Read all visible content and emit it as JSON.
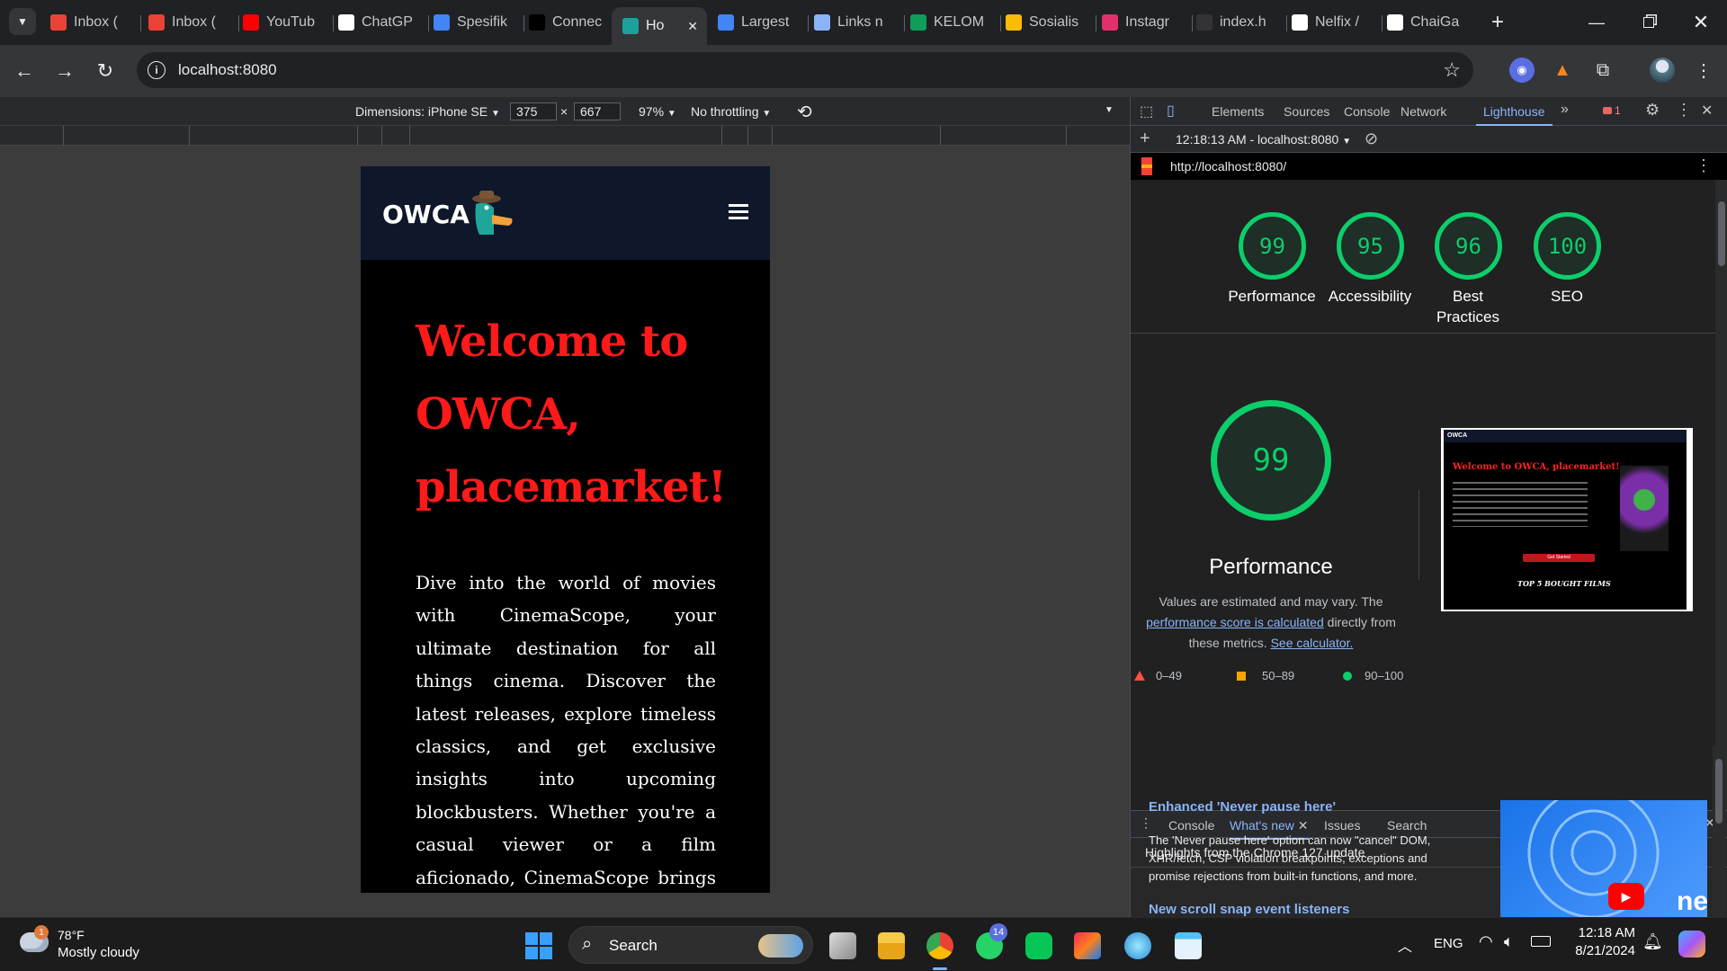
{
  "browser": {
    "tabs": [
      {
        "label": "Inbox (",
        "icon": "gmail-icon",
        "color": "#ea4335"
      },
      {
        "label": "Inbox (",
        "icon": "gmail-icon",
        "color": "#ea4335"
      },
      {
        "label": "YouTub",
        "icon": "youtube-icon",
        "color": "#ff0000"
      },
      {
        "label": "ChatGP",
        "icon": "chatgpt-icon",
        "color": "#ffffff"
      },
      {
        "label": "Spesifik",
        "icon": "docs-icon",
        "color": "#4285f4"
      },
      {
        "label": "Connec",
        "icon": "medium-icon",
        "color": "#000000"
      },
      {
        "label": "Ho",
        "icon": "owca-icon",
        "color": "#1aa39a"
      },
      {
        "label": "Largest",
        "icon": "google-icon",
        "color": "#4285f4"
      },
      {
        "label": "Links n",
        "icon": "links-icon",
        "color": "#8ab4f8"
      },
      {
        "label": "KELOM",
        "icon": "sheets-icon",
        "color": "#0f9d58"
      },
      {
        "label": "Sosialis",
        "icon": "drive-icon",
        "color": "#fbbc04"
      },
      {
        "label": "Instagr",
        "icon": "instagram-icon",
        "color": "#e1306c"
      },
      {
        "label": "index.h",
        "icon": "github-icon",
        "color": "#333333"
      },
      {
        "label": "Nelfix /",
        "icon": "nelfix-icon",
        "color": "#ffffff"
      },
      {
        "label": "ChaiGa",
        "icon": "github-icon",
        "color": "#ffffff"
      }
    ],
    "url": "localhost:8080"
  },
  "device_toolbar": {
    "dimensions_label": "Dimensions: iPhone SE",
    "width": "375",
    "height": "667",
    "times": "×",
    "zoom": "97%",
    "throttling": "No throttling"
  },
  "site": {
    "logo_text": "OWCA",
    "hero_title": "Welcome to OWCA, placemarket!",
    "hero_text": "Dive into the world of movies with CinemaScope, your ultimate destination for all things cinema. Discover the latest releases, explore timeless classics, and get exclusive insights into upcoming blockbusters. Whether you're a casual viewer or a film aficionado, CinemaScope brings you closer to the magic of movies. Browse"
  },
  "devtools": {
    "tabs": [
      "Elements",
      "Sources",
      "Console",
      "Network",
      "Lighthouse"
    ],
    "active_tab": "Lighthouse",
    "issues_count": "1",
    "report_selector": "12:18:13 AM - localhost:8080",
    "report_url": "http://localhost:8080/",
    "scores": [
      {
        "value": "99",
        "label": "Performance"
      },
      {
        "value": "95",
        "label": "Accessibility"
      },
      {
        "value": "96",
        "label": "Best Practices"
      },
      {
        "value": "100",
        "label": "SEO"
      }
    ],
    "main_score": "99",
    "main_label": "Performance",
    "note_prefix": "Values are estimated and may vary. The",
    "note_link1": "performance score is calculated",
    "note_middle": "directly from these metrics.",
    "note_link2": "See calculator.",
    "legend": [
      {
        "range": "0–49",
        "color": "#ff4e42"
      },
      {
        "range": "50–89",
        "color": "#ffa400"
      },
      {
        "range": "90–100",
        "color": "#0cce6b"
      }
    ],
    "thumb_title": "Welcome to OWCA, placemarket!",
    "thumb_caption": "TOP 5 BOUGHT FILMS",
    "thumb_button": "Get Started",
    "drawer_tabs": [
      "Console",
      "What's new",
      "Issues",
      "Search"
    ],
    "drawer_active": "What's new",
    "drawer_headline": "Highlights from the Chrome 127 update",
    "drawer_h1": "Enhanced 'Never pause here'",
    "drawer_p1": "The 'Never pause here' option can now \"cancel\" DOM, XHR/fetch, CSP violation breakpoints, exceptions and promise rejections from built-in functions, and more.",
    "drawer_h2": "New scroll snap event listeners",
    "video_text": "ne"
  },
  "taskbar": {
    "weather_temp": "78°F",
    "weather_desc": "Mostly cloudy",
    "weather_badge": "1",
    "search_label": "Search",
    "whatsapp_badge": "14",
    "lang": "ENG",
    "time": "12:18 AM",
    "date": "8/21/2024"
  }
}
